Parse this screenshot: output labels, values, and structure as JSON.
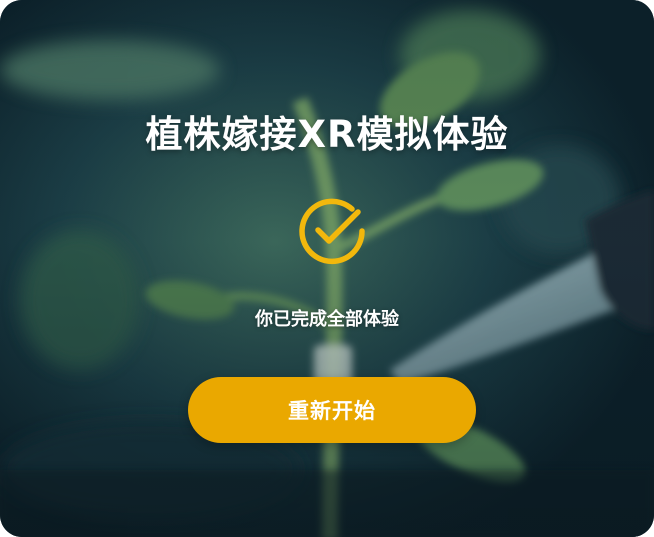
{
  "dialog": {
    "title": "植株嫁接XR模拟体验",
    "message": "你已完成全部体验",
    "restart_label": "重新开始"
  },
  "icons": {
    "status": "check-circle-icon"
  },
  "colors": {
    "accent": "#eaa800",
    "check": "#f2b80c",
    "text": "#ffffff"
  }
}
